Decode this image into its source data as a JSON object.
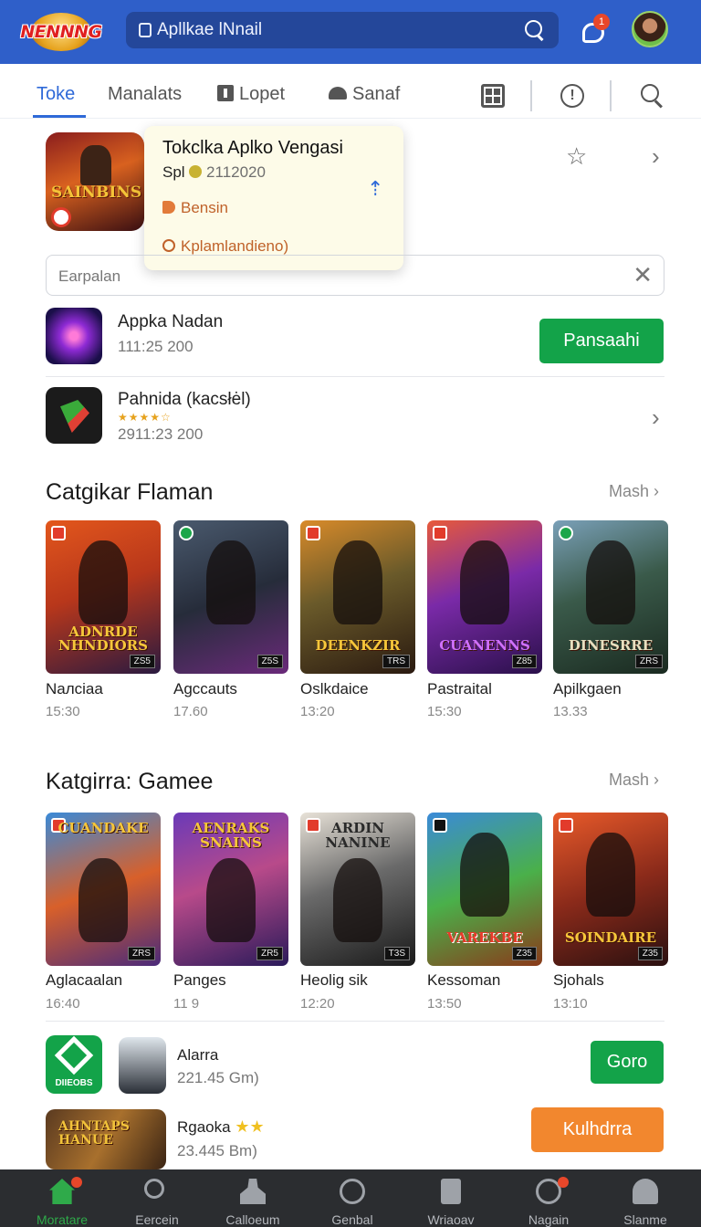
{
  "header": {
    "logo_text": "NENNNG",
    "search_text": "Apllkae lNnail",
    "search_prefix": "Ꮷ",
    "notification_count": "1"
  },
  "tabs": {
    "items": [
      {
        "label": "Toke"
      },
      {
        "label": "Manalats"
      },
      {
        "label": "Lopet"
      },
      {
        "label": "Sanaf"
      }
    ],
    "active_index": 0
  },
  "featured": {
    "thumb_text": "SAINBINS",
    "popup": {
      "title": "Tokclka Aplko Vengasi",
      "subtitle_label": "Spl",
      "subtitle_value": "2112020",
      "item1": "Bensin",
      "item2": "Kplamlandieno)"
    }
  },
  "filter": {
    "placeholder": "Earpalan"
  },
  "apps": [
    {
      "name": "Appka Nadan",
      "meta": "111:25 200",
      "button": "Pansaahi"
    },
    {
      "name": "Pahnida (kacsłėl)",
      "meta": "2911:23 200",
      "stars": "★★★★☆"
    }
  ],
  "section1": {
    "title": "Catgikar Flaman",
    "more": "Mash",
    "cards": [
      {
        "label": "Naлciaa",
        "time": "15:30",
        "art": "ADNRDE NHNDIORS",
        "tag": "ZS5"
      },
      {
        "label": "Agccauts",
        "time": "17.60",
        "art": "",
        "tag": "Z5S"
      },
      {
        "label": "Oslkdaice",
        "time": "13:20",
        "art": "DEENKZIR",
        "tag": "TRS"
      },
      {
        "label": "Pastraital",
        "time": "15:30",
        "art": "CUANENNS",
        "tag": "Z85"
      },
      {
        "label": "Apilkgaen",
        "time": "13.33",
        "art": "DINESRRE",
        "tag": "ZRS"
      }
    ]
  },
  "section2": {
    "title": "Katgirra: Gamee",
    "more": "Mash",
    "cards": [
      {
        "label": "Aglacaalan",
        "time": "16:40",
        "art": "CUANDAKE",
        "tag": "ZRS"
      },
      {
        "label": "Panges",
        "time": "11 9",
        "art": "AENRAKS SNAINS",
        "tag": "ZR5"
      },
      {
        "label": "Heolig sik",
        "time": "12:20",
        "art": "ARDIN NANINE",
        "tag": "T3S"
      },
      {
        "label": "Kessoman",
        "time": "13:50",
        "art": "VAREKBE",
        "tag": "Z35"
      },
      {
        "label": "Sjohals",
        "time": "13:10",
        "art": "SOINDAIRE",
        "tag": "Z35"
      }
    ]
  },
  "bottom_apps": [
    {
      "name": "Alarra",
      "meta": "221.45 Gm)",
      "button": "Goro",
      "icon_text": "DIIEOBS"
    },
    {
      "name": "Rgaoka",
      "meta": "23.445 Bm)",
      "button": "Kulhdrra",
      "icon_text": "AHNTAPS HANUE",
      "stars": "★★"
    }
  ],
  "bottom_nav": [
    {
      "label": "Moratare",
      "icon": "home-icon"
    },
    {
      "label": "Eercein",
      "icon": "search-icon"
    },
    {
      "label": "Calloeum",
      "icon": "person-icon"
    },
    {
      "label": "Genbal",
      "icon": "smile-icon"
    },
    {
      "label": "Wriaoav",
      "icon": "book-icon"
    },
    {
      "label": "Nagain",
      "icon": "ring-icon"
    },
    {
      "label": "Slanme",
      "icon": "user-icon"
    }
  ],
  "colors": {
    "brand_blue": "#2f5fc9",
    "accent_blue": "#2f6ad8",
    "button_green": "#13a349",
    "button_orange": "#f2872e",
    "nav_bg": "#2b2d30"
  }
}
